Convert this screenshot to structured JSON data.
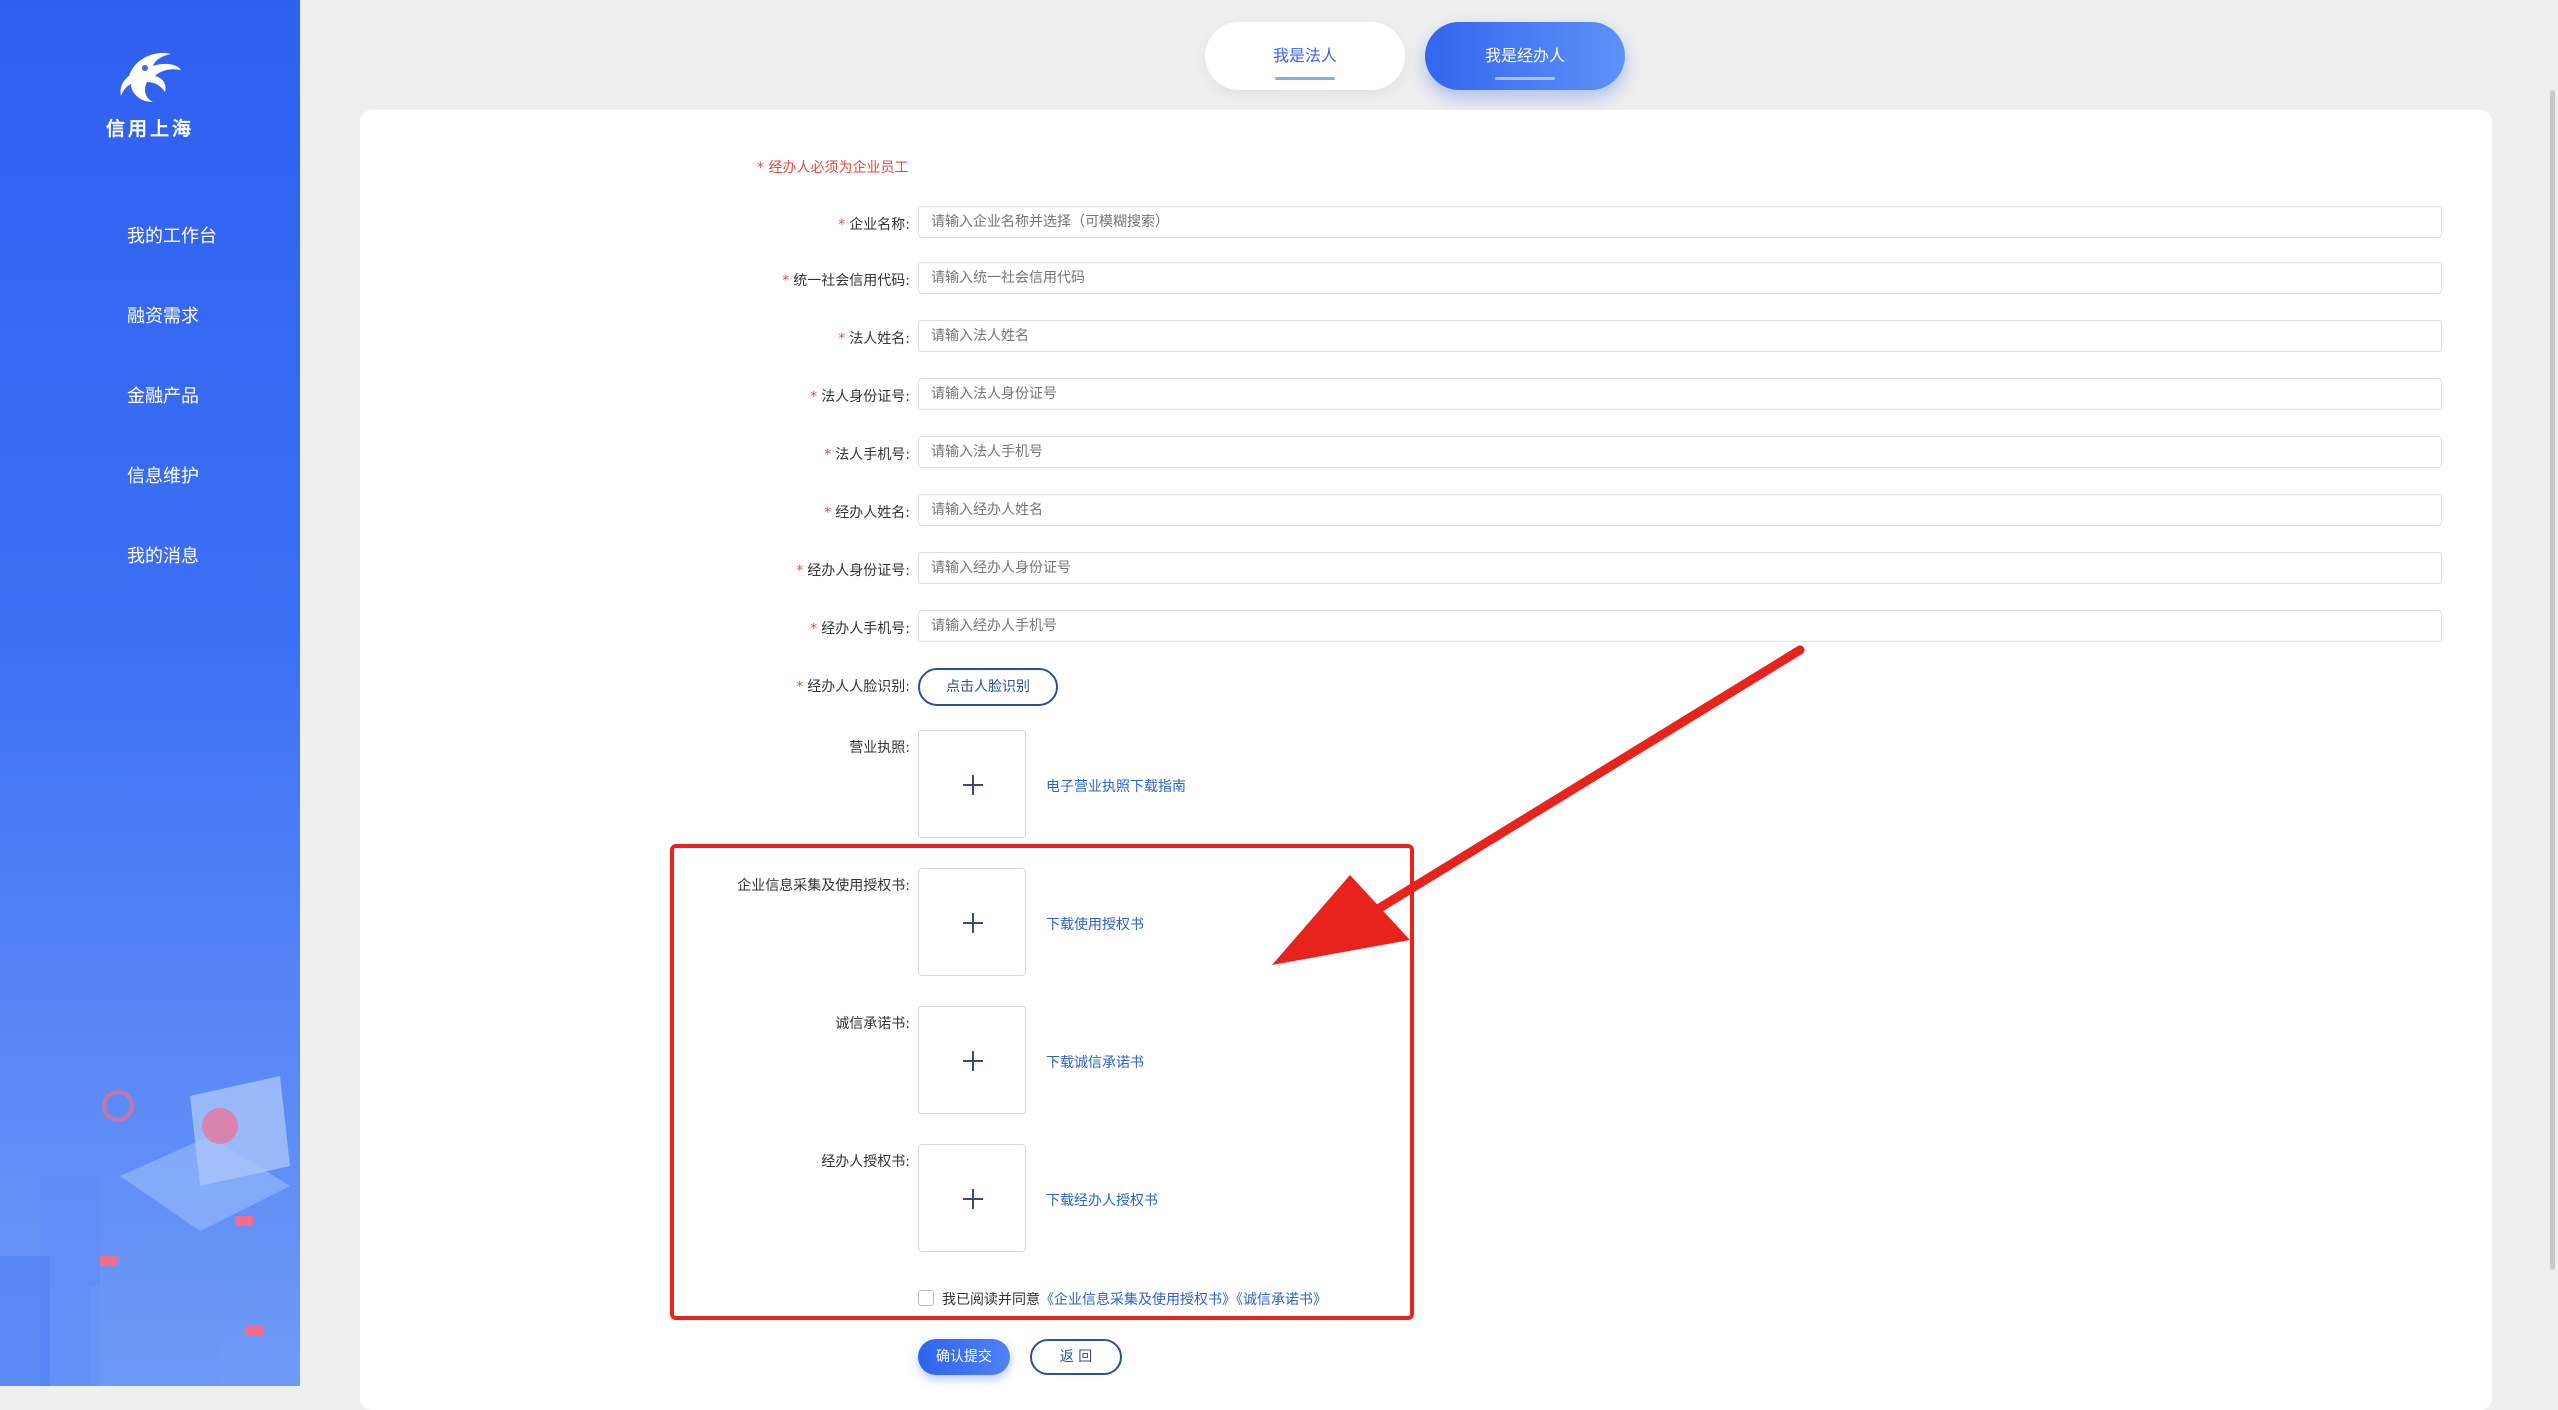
{
  "sidebar": {
    "logo_text": "信用上海",
    "items": [
      {
        "label": "我的工作台"
      },
      {
        "label": "融资需求"
      },
      {
        "label": "金融产品"
      },
      {
        "label": "信息维护"
      },
      {
        "label": "我的消息"
      }
    ]
  },
  "tabs": {
    "legal": "我是法人",
    "agent": "我是经办人",
    "active": "agent"
  },
  "form": {
    "notice": "* 经办人必须为企业员工",
    "fields": [
      {
        "label": "企业名称:",
        "placeholder": "请输入企业名称并选择（可模糊搜索）"
      },
      {
        "label": "统一社会信用代码:",
        "placeholder": "请输入统一社会信用代码"
      },
      {
        "label": "法人姓名:",
        "placeholder": "请输入法人姓名"
      },
      {
        "label": "法人身份证号:",
        "placeholder": "请输入法人身份证号"
      },
      {
        "label": "法人手机号:",
        "placeholder": "请输入法人手机号"
      },
      {
        "label": "经办人姓名:",
        "placeholder": "请输入经办人姓名"
      },
      {
        "label": "经办人身份证号:",
        "placeholder": "请输入经办人身份证号"
      },
      {
        "label": "经办人手机号:",
        "placeholder": "请输入经办人手机号"
      }
    ],
    "face": {
      "label": "经办人人脸识别:",
      "button": "点击人脸识别"
    },
    "uploads": [
      {
        "label": "营业执照:",
        "link": "电子营业执照下载指南"
      },
      {
        "label": "企业信息采集及使用授权书:",
        "link": "下载使用授权书"
      },
      {
        "label": "诚信承诺书:",
        "link": "下载诚信承诺书"
      },
      {
        "label": "经办人授权书:",
        "link": "下载经办人授权书"
      }
    ],
    "agree": {
      "prefix": "我已阅读并同意",
      "doc1": "《企业信息采集及使用授权书》",
      "doc2": "《诚信承诺书》"
    },
    "submit": "确认提交",
    "back": "返 回"
  },
  "colors": {
    "primary": "#3365ee",
    "required": "#e24a3b",
    "link": "#2e63c8",
    "annotation": "#e8231b"
  }
}
